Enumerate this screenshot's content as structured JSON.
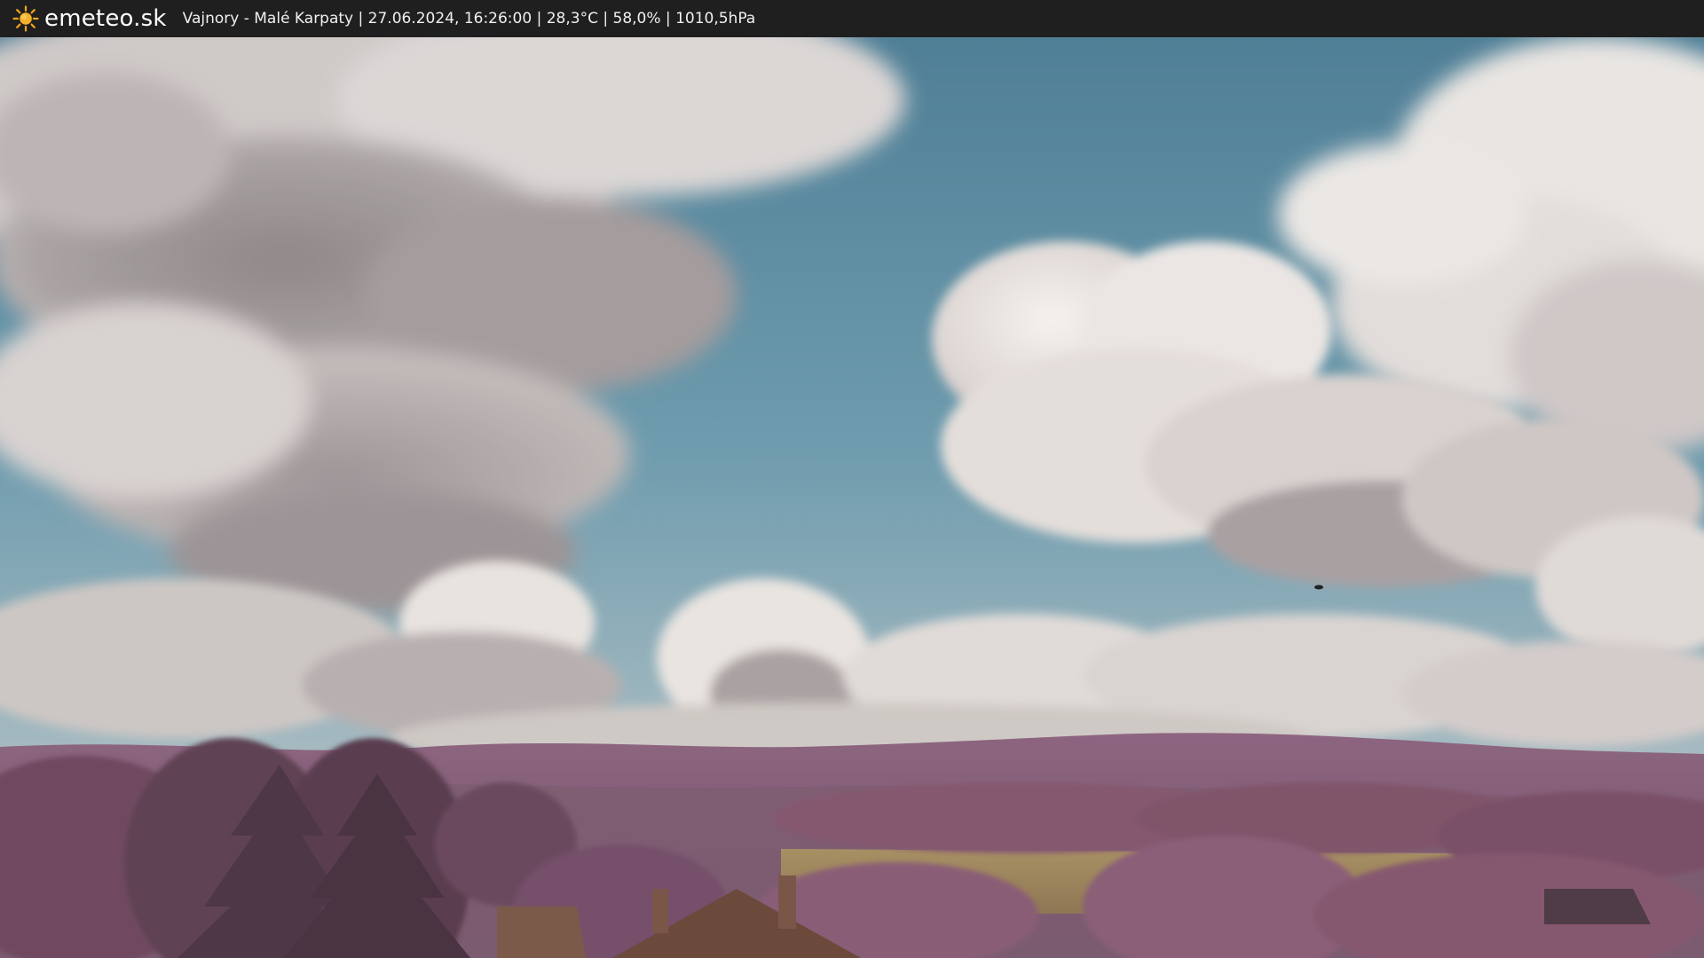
{
  "header": {
    "brand": "emeteo.sk",
    "location": "Vajnory - Malé Karpaty",
    "datetime": "27.06.2024, 16:26:00",
    "temperature": "28,3°C",
    "humidity": "58,0%",
    "pressure": "1010,5hPa",
    "separator": " | "
  },
  "icons": {
    "brand_icon": "sun-icon"
  },
  "colors": {
    "sun": "#f5a51c",
    "topbar": "#1f1f1f",
    "sky": "#5f8fa3",
    "vegetation": "#8a5a79"
  }
}
